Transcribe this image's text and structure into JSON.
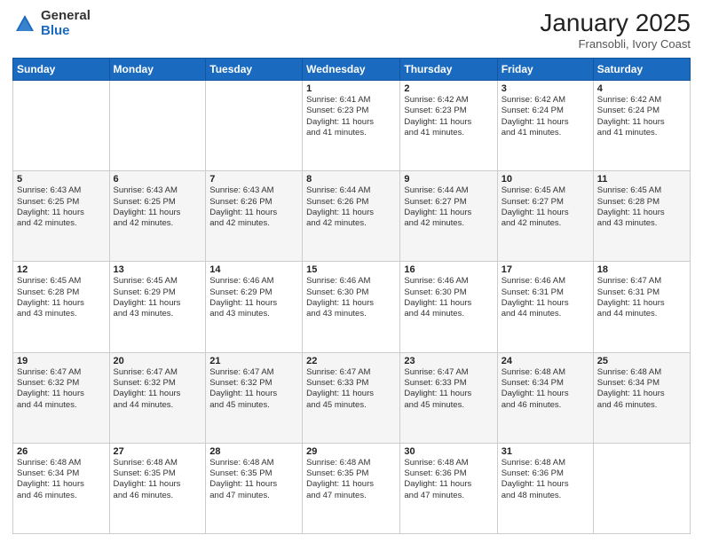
{
  "logo": {
    "general": "General",
    "blue": "Blue"
  },
  "header": {
    "month": "January 2025",
    "location": "Fransobli, Ivory Coast"
  },
  "weekdays": [
    "Sunday",
    "Monday",
    "Tuesday",
    "Wednesday",
    "Thursday",
    "Friday",
    "Saturday"
  ],
  "weeks": [
    [
      {
        "day": "",
        "info": ""
      },
      {
        "day": "",
        "info": ""
      },
      {
        "day": "",
        "info": ""
      },
      {
        "day": "1",
        "info": "Sunrise: 6:41 AM\nSunset: 6:23 PM\nDaylight: 11 hours\nand 41 minutes."
      },
      {
        "day": "2",
        "info": "Sunrise: 6:42 AM\nSunset: 6:23 PM\nDaylight: 11 hours\nand 41 minutes."
      },
      {
        "day": "3",
        "info": "Sunrise: 6:42 AM\nSunset: 6:24 PM\nDaylight: 11 hours\nand 41 minutes."
      },
      {
        "day": "4",
        "info": "Sunrise: 6:42 AM\nSunset: 6:24 PM\nDaylight: 11 hours\nand 41 minutes."
      }
    ],
    [
      {
        "day": "5",
        "info": "Sunrise: 6:43 AM\nSunset: 6:25 PM\nDaylight: 11 hours\nand 42 minutes."
      },
      {
        "day": "6",
        "info": "Sunrise: 6:43 AM\nSunset: 6:25 PM\nDaylight: 11 hours\nand 42 minutes."
      },
      {
        "day": "7",
        "info": "Sunrise: 6:43 AM\nSunset: 6:26 PM\nDaylight: 11 hours\nand 42 minutes."
      },
      {
        "day": "8",
        "info": "Sunrise: 6:44 AM\nSunset: 6:26 PM\nDaylight: 11 hours\nand 42 minutes."
      },
      {
        "day": "9",
        "info": "Sunrise: 6:44 AM\nSunset: 6:27 PM\nDaylight: 11 hours\nand 42 minutes."
      },
      {
        "day": "10",
        "info": "Sunrise: 6:45 AM\nSunset: 6:27 PM\nDaylight: 11 hours\nand 42 minutes."
      },
      {
        "day": "11",
        "info": "Sunrise: 6:45 AM\nSunset: 6:28 PM\nDaylight: 11 hours\nand 43 minutes."
      }
    ],
    [
      {
        "day": "12",
        "info": "Sunrise: 6:45 AM\nSunset: 6:28 PM\nDaylight: 11 hours\nand 43 minutes."
      },
      {
        "day": "13",
        "info": "Sunrise: 6:45 AM\nSunset: 6:29 PM\nDaylight: 11 hours\nand 43 minutes."
      },
      {
        "day": "14",
        "info": "Sunrise: 6:46 AM\nSunset: 6:29 PM\nDaylight: 11 hours\nand 43 minutes."
      },
      {
        "day": "15",
        "info": "Sunrise: 6:46 AM\nSunset: 6:30 PM\nDaylight: 11 hours\nand 43 minutes."
      },
      {
        "day": "16",
        "info": "Sunrise: 6:46 AM\nSunset: 6:30 PM\nDaylight: 11 hours\nand 44 minutes."
      },
      {
        "day": "17",
        "info": "Sunrise: 6:46 AM\nSunset: 6:31 PM\nDaylight: 11 hours\nand 44 minutes."
      },
      {
        "day": "18",
        "info": "Sunrise: 6:47 AM\nSunset: 6:31 PM\nDaylight: 11 hours\nand 44 minutes."
      }
    ],
    [
      {
        "day": "19",
        "info": "Sunrise: 6:47 AM\nSunset: 6:32 PM\nDaylight: 11 hours\nand 44 minutes."
      },
      {
        "day": "20",
        "info": "Sunrise: 6:47 AM\nSunset: 6:32 PM\nDaylight: 11 hours\nand 44 minutes."
      },
      {
        "day": "21",
        "info": "Sunrise: 6:47 AM\nSunset: 6:32 PM\nDaylight: 11 hours\nand 45 minutes."
      },
      {
        "day": "22",
        "info": "Sunrise: 6:47 AM\nSunset: 6:33 PM\nDaylight: 11 hours\nand 45 minutes."
      },
      {
        "day": "23",
        "info": "Sunrise: 6:47 AM\nSunset: 6:33 PM\nDaylight: 11 hours\nand 45 minutes."
      },
      {
        "day": "24",
        "info": "Sunrise: 6:48 AM\nSunset: 6:34 PM\nDaylight: 11 hours\nand 46 minutes."
      },
      {
        "day": "25",
        "info": "Sunrise: 6:48 AM\nSunset: 6:34 PM\nDaylight: 11 hours\nand 46 minutes."
      }
    ],
    [
      {
        "day": "26",
        "info": "Sunrise: 6:48 AM\nSunset: 6:34 PM\nDaylight: 11 hours\nand 46 minutes."
      },
      {
        "day": "27",
        "info": "Sunrise: 6:48 AM\nSunset: 6:35 PM\nDaylight: 11 hours\nand 46 minutes."
      },
      {
        "day": "28",
        "info": "Sunrise: 6:48 AM\nSunset: 6:35 PM\nDaylight: 11 hours\nand 47 minutes."
      },
      {
        "day": "29",
        "info": "Sunrise: 6:48 AM\nSunset: 6:35 PM\nDaylight: 11 hours\nand 47 minutes."
      },
      {
        "day": "30",
        "info": "Sunrise: 6:48 AM\nSunset: 6:36 PM\nDaylight: 11 hours\nand 47 minutes."
      },
      {
        "day": "31",
        "info": "Sunrise: 6:48 AM\nSunset: 6:36 PM\nDaylight: 11 hours\nand 48 minutes."
      },
      {
        "day": "",
        "info": ""
      }
    ]
  ]
}
